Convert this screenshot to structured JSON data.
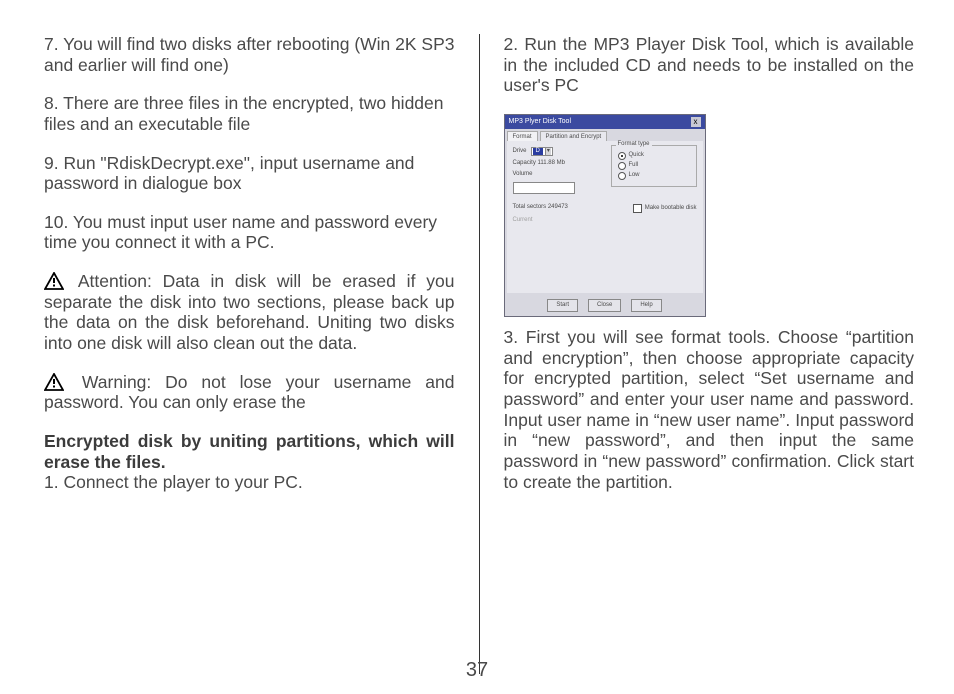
{
  "page_number": "37",
  "left": {
    "p7": "7. You will find two disks after rebooting (Win 2K SP3 and earlier will find one)",
    "p8": "8. There are three files in the encrypted, two hidden files and an executable file",
    "p9": "9. Run \"RdiskDecrypt.exe\", input username and password in dialogue box",
    "p10": "10. You must input user name and password every time you connect it with a PC.",
    "attention": " Attention: Data in disk will be erased if you separate the disk into two sections, please back up the data on the disk beforehand. Uniting two disks into one disk will also clean out the data.",
    "warning": " Warning: Do not lose your username and password. You can only erase the",
    "bold_heading": "Encrypted disk by uniting partitions, which will erase the files.",
    "step1": "1. Connect the player to your PC."
  },
  "right": {
    "p2": "2. Run the MP3 Player Disk Tool, which is available in the included CD and needs to be installed on the user's PC",
    "p3": "3. First you will see format tools. Choose “partition and encryption”, then choose appropriate capacity for encrypted partition, select “Set username and password”  and enter your user name and password. Input user name in “new user name”. Input password in “new password”, and then input the same password in “new password”  confirmation. Click start to create the partition."
  },
  "dialog": {
    "title": "MP3 Plyer Disk Tool",
    "close": "x",
    "tabs": [
      "Format",
      "Partition and Encrypt"
    ],
    "drive_label": "Drive",
    "drive_value": "D",
    "capacity": "Capacity 111.88 Mb",
    "volume_label": "Volume",
    "group_title": "Format type",
    "opt_quick": "Quick",
    "opt_full": "Full",
    "opt_low": "Low",
    "sectors": "Total sectors 249473",
    "bootable": "Make bootable disk",
    "current": "Current",
    "btn_start": "Start",
    "btn_close": "Close",
    "btn_help": "Help"
  }
}
